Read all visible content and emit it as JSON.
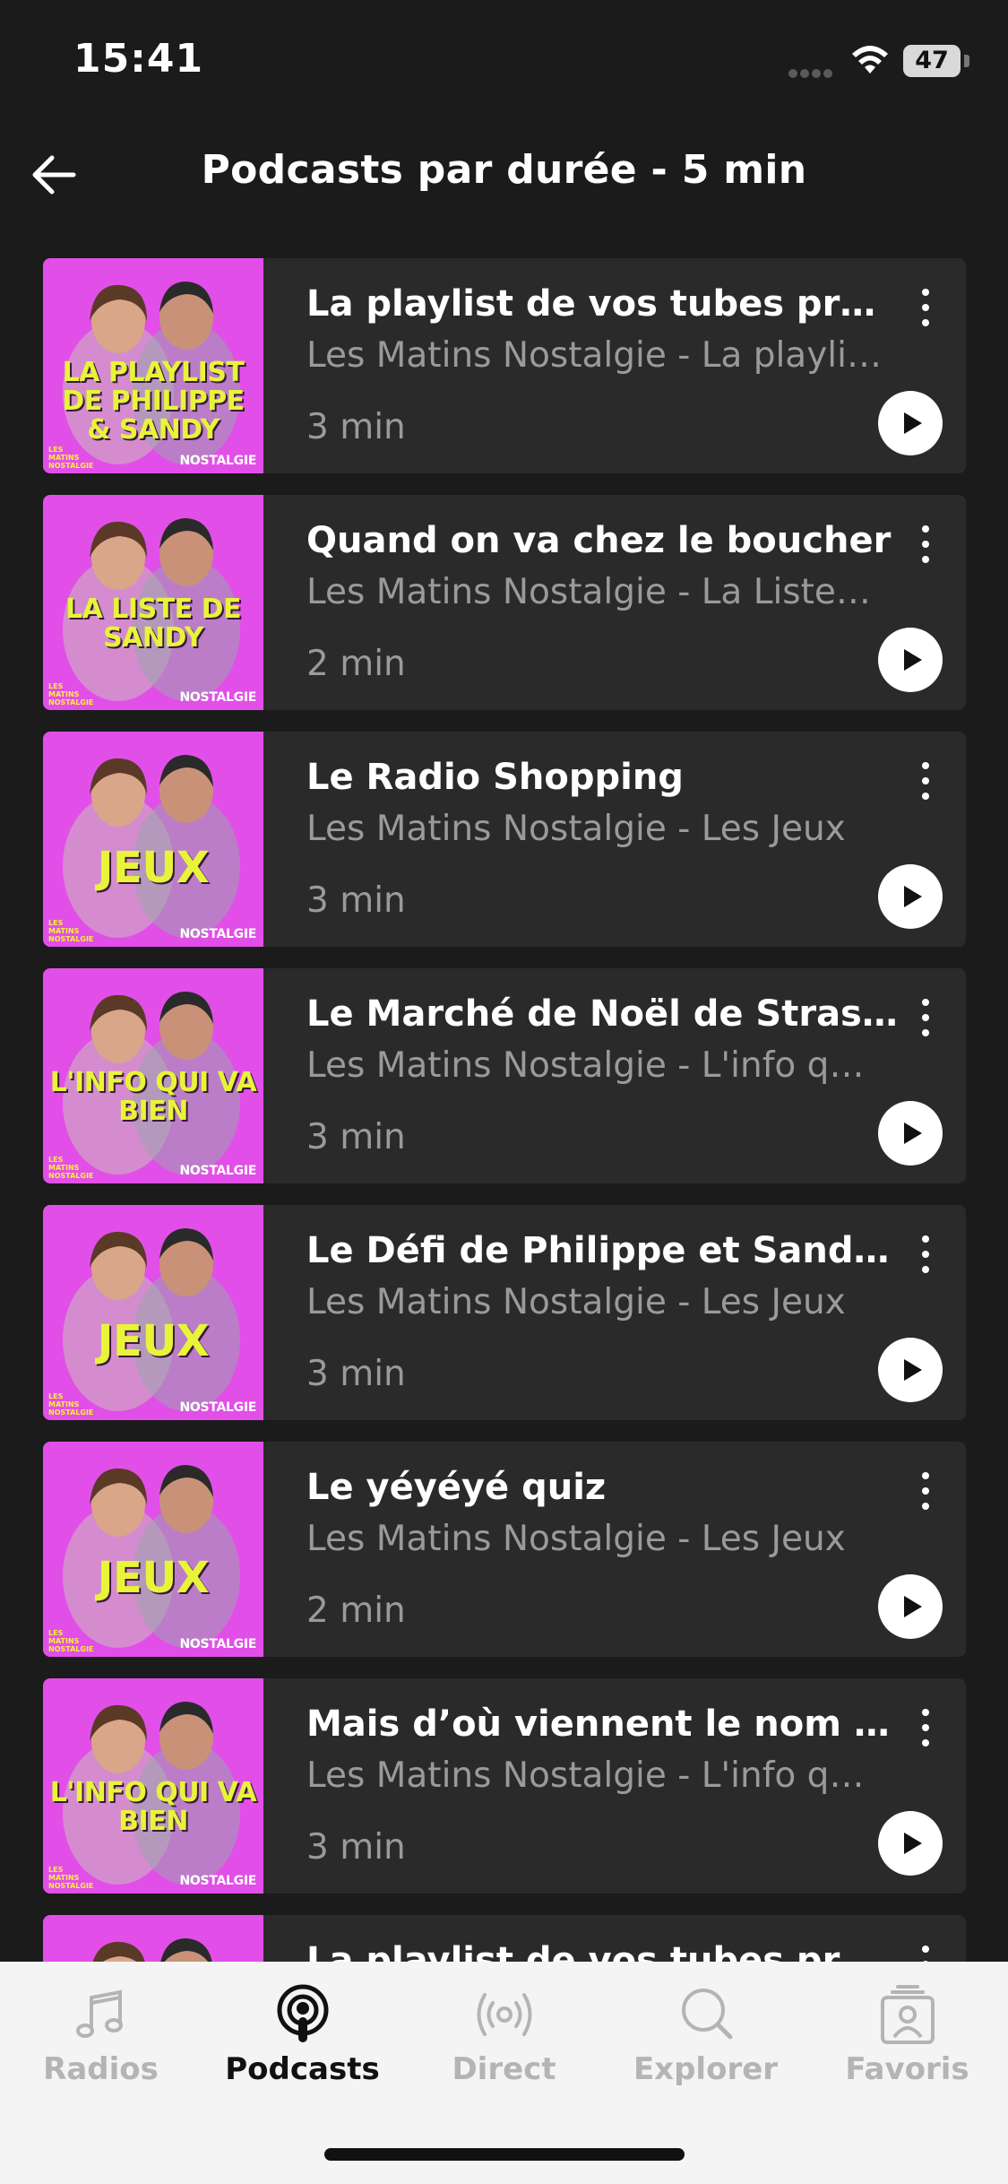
{
  "status_bar": {
    "time": "15:41",
    "battery": "47"
  },
  "header": {
    "title": "Podcasts par durée - 5 min"
  },
  "episodes": [
    {
      "title": "La playlist de vos tubes préf…",
      "show": "Les Matins Nostalgie - La playli…",
      "duration": "3 min",
      "cover_text": "LA PLAYLIST DE PHILIPPE & SANDY",
      "cover_brand": "NOSTALGIE",
      "cover_sub": "LES MATINS NOSTALGIE"
    },
    {
      "title": "Quand on va chez le boucher",
      "show": "Les Matins Nostalgie - La Liste…",
      "duration": "2 min",
      "cover_text": "LA LISTE DE SANDY",
      "cover_brand": "NOSTALGIE",
      "cover_sub": "LES MATINS NOSTALGIE"
    },
    {
      "title": "Le Radio Shopping",
      "show": "Les Matins Nostalgie - Les Jeux",
      "duration": "3 min",
      "cover_text": "JEUX",
      "cover_brand": "NOSTALGIE",
      "cover_sub": "LES MATINS NOSTALGIE"
    },
    {
      "title": "Le Marché de Noël de Strasb…",
      "show": "Les Matins Nostalgie - L'info q…",
      "duration": "3 min",
      "cover_text": "L'INFO QUI VA BIEN",
      "cover_brand": "NOSTALGIE",
      "cover_sub": "LES MATINS NOSTALGIE"
    },
    {
      "title": "Le Défi de Philippe et Sandy…",
      "show": "Les Matins Nostalgie - Les Jeux",
      "duration": "3 min",
      "cover_text": "JEUX",
      "cover_brand": "NOSTALGIE",
      "cover_sub": "LES MATINS NOSTALGIE"
    },
    {
      "title": "Le yéyéyé quiz",
      "show": "Les Matins Nostalgie - Les Jeux",
      "duration": "2 min",
      "cover_text": "JEUX",
      "cover_brand": "NOSTALGIE",
      "cover_sub": "LES MATINS NOSTALGIE"
    },
    {
      "title": "Mais d’où viennent le nom de…",
      "show": "Les Matins Nostalgie - L'info q…",
      "duration": "3 min",
      "cover_text": "L'INFO QUI VA BIEN",
      "cover_brand": "NOSTALGIE",
      "cover_sub": "LES MATINS NOSTALGIE"
    },
    {
      "title": "La playlist de vos tubes préf…",
      "show": "",
      "duration": "",
      "cover_text": "",
      "cover_brand": "",
      "cover_sub": ""
    }
  ],
  "tab_bar": {
    "tabs": [
      {
        "label": "Radios",
        "icon": "music-note-icon",
        "active": false
      },
      {
        "label": "Podcasts",
        "icon": "podcast-icon",
        "active": true
      },
      {
        "label": "Direct",
        "icon": "broadcast-icon",
        "active": false
      },
      {
        "label": "Explorer",
        "icon": "search-icon",
        "active": false
      },
      {
        "label": "Favoris",
        "icon": "favorites-stack-icon",
        "active": false
      }
    ]
  },
  "colors": {
    "background": "#1b1b1b",
    "card": "#2a2a2a",
    "cover_pink": "#e24fe8",
    "cover_yellow": "#e7f43a",
    "tab_active": "#111111",
    "tab_inactive": "#b4b4b4"
  }
}
